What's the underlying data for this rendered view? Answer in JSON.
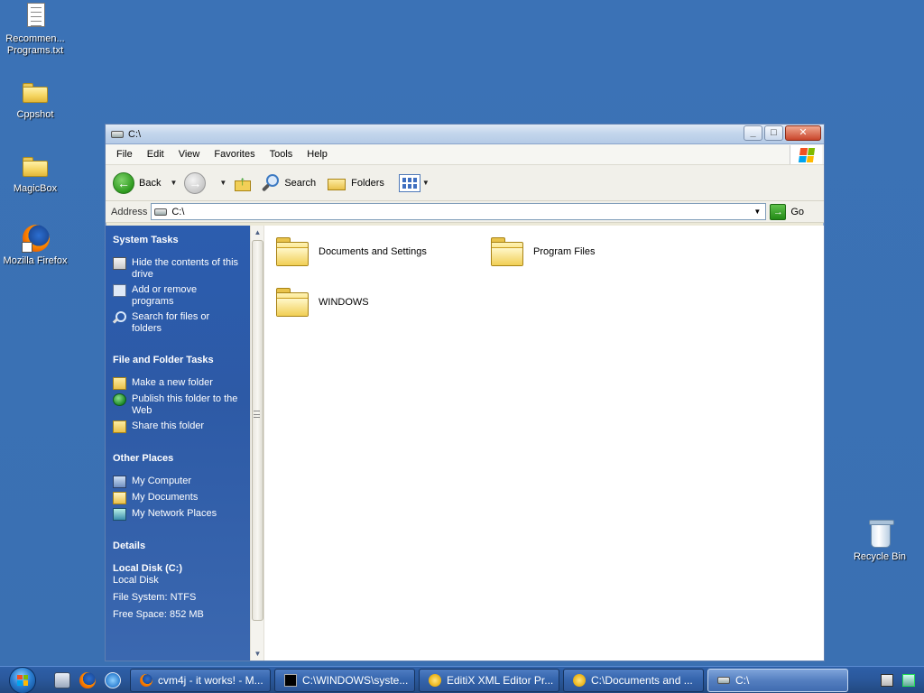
{
  "desktop": {
    "icons": [
      {
        "label": "Recommen... Programs.txt",
        "icon": "text-document-icon"
      },
      {
        "label": "Cppshot",
        "icon": "folder-icon"
      },
      {
        "label": "MagicBox",
        "icon": "folder-icon"
      },
      {
        "label": "Mozilla Firefox",
        "icon": "firefox-icon"
      },
      {
        "label": "Recycle Bin",
        "icon": "recycle-bin-icon"
      }
    ]
  },
  "window": {
    "title": "C:\\",
    "menu": [
      "File",
      "Edit",
      "View",
      "Favorites",
      "Tools",
      "Help"
    ],
    "toolbar": {
      "back_label": "Back",
      "search_label": "Search",
      "folders_label": "Folders"
    },
    "address": {
      "label": "Address",
      "value": "C:\\",
      "go_label": "Go"
    },
    "taskpane": {
      "system_tasks": {
        "header": "System Tasks",
        "items": [
          {
            "label": "Hide the contents of this drive"
          },
          {
            "label": "Add or remove programs"
          },
          {
            "label": "Search for files or folders"
          }
        ]
      },
      "file_folder_tasks": {
        "header": "File and Folder Tasks",
        "items": [
          {
            "label": "Make a new folder"
          },
          {
            "label": "Publish this folder to the Web"
          },
          {
            "label": "Share this folder"
          }
        ]
      },
      "other_places": {
        "header": "Other Places",
        "items": [
          {
            "label": "My Computer"
          },
          {
            "label": "My Documents"
          },
          {
            "label": "My Network Places"
          }
        ]
      },
      "details": {
        "header": "Details",
        "disk_name": "Local Disk (C:)",
        "disk_type": "Local Disk",
        "file_system": "File System: NTFS",
        "free_space": "Free Space: 852 MB"
      }
    },
    "files": [
      {
        "name": "Documents and Settings"
      },
      {
        "name": "Program Files"
      },
      {
        "name": "WINDOWS"
      }
    ]
  },
  "taskbar": {
    "tasks": [
      {
        "label": "cvm4j - it works! - M...",
        "icon": "firefox-icon",
        "active": false
      },
      {
        "label": "C:\\WINDOWS\\syste...",
        "icon": "command-prompt-icon",
        "active": false
      },
      {
        "label": "EditiX XML Editor Pr...",
        "icon": "editix-icon",
        "active": false
      },
      {
        "label": "C:\\Documents and ...",
        "icon": "explorer-icon",
        "active": false
      },
      {
        "label": "C:\\",
        "icon": "drive-icon",
        "active": true
      }
    ]
  },
  "colors": {
    "desktop": "#3a70b2",
    "taskpane": "#2c5daf",
    "taskbar": "#2a579a"
  }
}
